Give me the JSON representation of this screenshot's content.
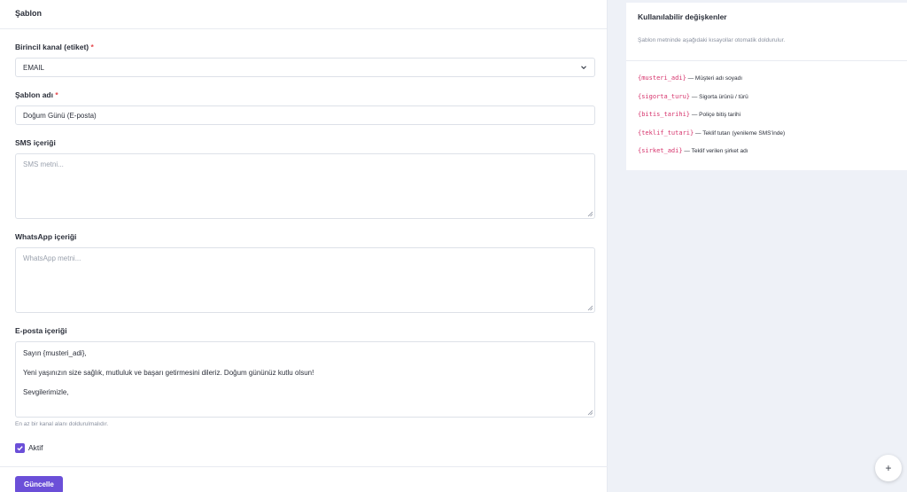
{
  "form": {
    "title": "Şablon",
    "channel": {
      "label": "Birincil kanal (etiket)",
      "required_mark": "*",
      "value": "EMAIL"
    },
    "template_name": {
      "label": "Şablon adı",
      "required_mark": "*",
      "value": "Doğum Günü (E-posta)"
    },
    "sms": {
      "label": "SMS içeriği",
      "placeholder": "SMS metni..."
    },
    "whatsapp": {
      "label": "WhatsApp içeriği",
      "placeholder": "WhatsApp metni..."
    },
    "email": {
      "label": "E-posta içeriği",
      "lines": [
        "Sayın {musteri_adi},",
        "",
        "Yeni yaşınızın size sağlık, mutluluk ve başarı getirmesini dileriz. Doğum gününüz kutlu olsun!",
        "",
        "Sevgilerimizle,"
      ]
    },
    "hint": "En az bir kanal alanı doldurulmalıdır.",
    "active": {
      "label": "Aktif",
      "checked": true
    },
    "submit_label": "Güncelle"
  },
  "variables": {
    "title": "Kullanılabilir değişkenler",
    "subtitle": "Şablon metninde aşağıdaki kısayollar otomatik doldurulur.",
    "items": [
      {
        "code": "{musteri_adi}",
        "desc": " — Müşteri adı soyadı"
      },
      {
        "code": "{sigorta_turu}",
        "desc": " — Sigorta ürünü / türü"
      },
      {
        "code": "{bitis_tarihi}",
        "desc": " — Poliçe bitiş tarihi"
      },
      {
        "code": "{teklif_tutari}",
        "desc": " — Teklif tutarı (yenileme SMS'inde)"
      },
      {
        "code": "{sirket_adi}",
        "desc": " — Teklif verilen şirket adı"
      }
    ]
  },
  "fab": {
    "label": "+"
  },
  "colors": {
    "accent": "#6b4fd8",
    "variable_code": "#d6336c",
    "required": "#e5484d"
  }
}
